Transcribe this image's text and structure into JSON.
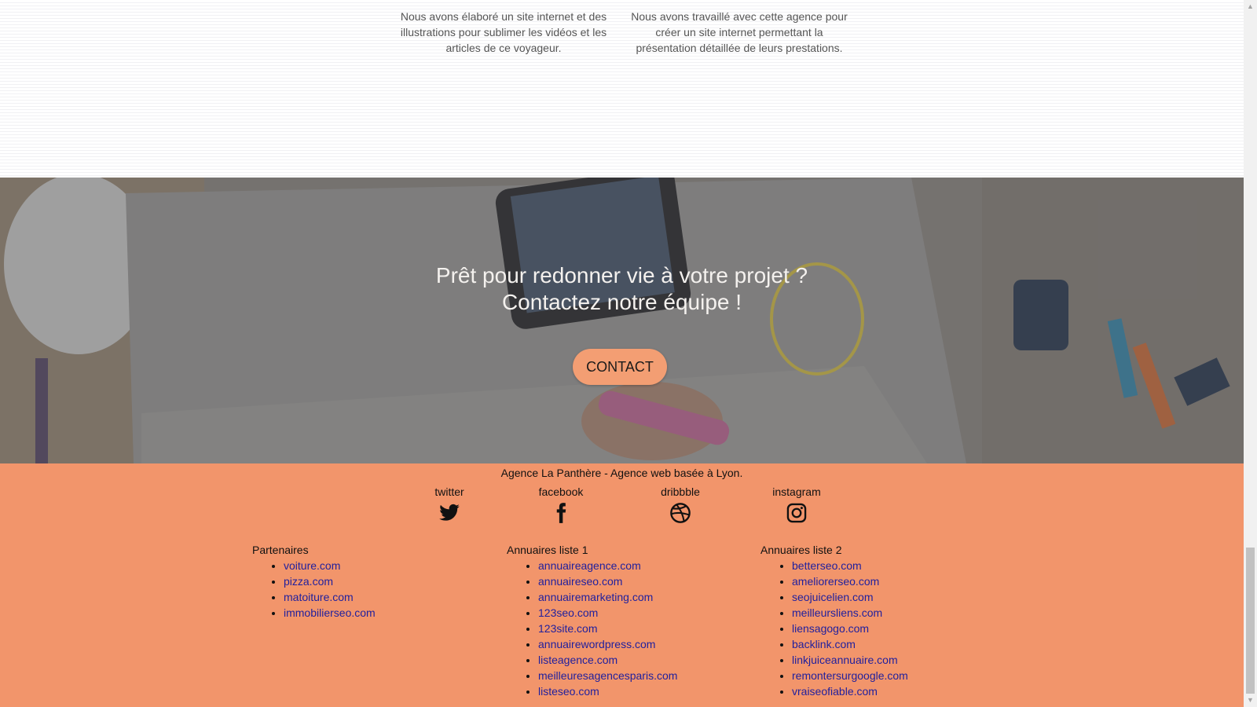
{
  "portfolio": {
    "item1_text": "Nous avons élaboré un site internet et des illustrations pour sublimer les vidéos et les articles de ce voyageur.",
    "item2_text": "Nous avons travaillé avec cette agence pour créer un site internet permettant la présentation détaillée de leurs prestations."
  },
  "cta": {
    "title_line1": "Prêt pour redonner vie à votre projet ?",
    "title_line2": "Contactez notre équipe !",
    "button_label": "CONTACT"
  },
  "footer": {
    "agency_text": "Agence La Panthère - Agence web basée à Lyon.",
    "social": [
      {
        "label": "twitter",
        "icon": "twitter-icon"
      },
      {
        "label": "facebook",
        "icon": "facebook-icon"
      },
      {
        "label": "dribbble",
        "icon": "dribbble-icon"
      },
      {
        "label": "instagram",
        "icon": "instagram-icon"
      }
    ],
    "columns": [
      {
        "title": "Partenaires",
        "links": [
          "voiture.com",
          "pizza.com",
          "matoiture.com",
          "immobilierseo.com"
        ]
      },
      {
        "title": "Annuaires liste 1",
        "links": [
          "annuaireagence.com",
          "annuaireseo.com",
          "annuairemarketing.com",
          "123seo.com",
          "123site.com",
          "annuairewordpress.com",
          "listeagence.com",
          "meilleuresagencesparis.com",
          "listeseo.com"
        ]
      },
      {
        "title": "Annuaires liste 2",
        "links": [
          "betterseo.com",
          "ameliorerseo.com",
          "seojuicelien.com",
          "meilleursliens.com",
          "liensagogo.com",
          "backlink.com",
          "linkjuiceannuaire.com",
          "remontersurgoogle.com",
          "vraiseofiable.com"
        ]
      }
    ]
  },
  "colors": {
    "footer_bg": "#f2956b",
    "button_bg": "#f39e73",
    "link": "#1f1f9e"
  }
}
